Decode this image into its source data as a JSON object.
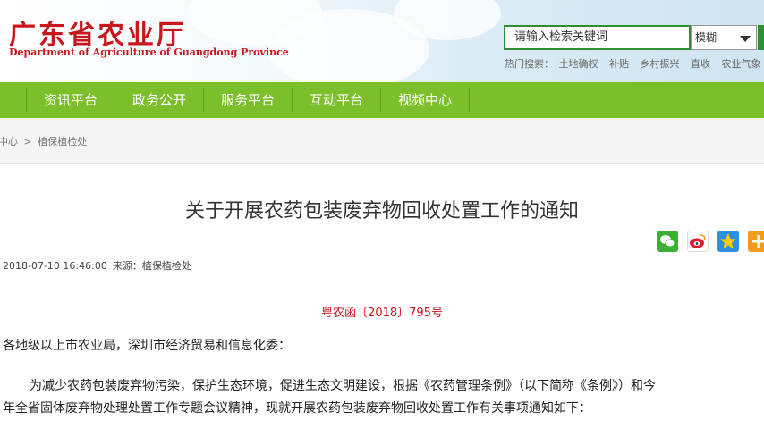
{
  "header": {
    "site_title_cn": "广东省农业厅",
    "site_title_en": "Department of Agriculture of Guangdong Province",
    "search": {
      "placeholder": "请输入检索关键词",
      "mode_selected": "模糊",
      "hot_label": "热门搜索：",
      "hot_terms": [
        "土地确权",
        "补贴",
        "乡村振兴",
        "直收",
        "农业气象"
      ]
    }
  },
  "nav": {
    "items": [
      "资讯平台",
      "政务公开",
      "服务平台",
      "互动平台",
      "视频中心"
    ]
  },
  "breadcrumb": {
    "items": [
      "中心",
      "植保植检处"
    ],
    "separator": ">"
  },
  "article": {
    "title": "关于开展农药包装废弃物回收处置工作的通知",
    "share_icons": [
      "wechat-icon",
      "weibo-icon",
      "qzone-icon",
      "more-share-icon"
    ],
    "date": "2018-07-10 16:46:00",
    "source_label": "来源：",
    "source": "植保植检处",
    "doc_number": "粤农函〔2018〕795号",
    "salutation": "各地级以上市农业局，深圳市经济贸易和信息化委：",
    "body_line1": "为减少农药包装废弃物污染，保护生态环境，促进生态文明建设，根据《农药管理条例》（以下简称《条例》）和今",
    "body_line2": "年全省固体废弃物处理处置工作专题会议精神，现就开展农药包装废弃物回收处置工作有关事项通知如下："
  },
  "colors": {
    "brand_red": "#c8161d",
    "nav_green": "#7bbf2b",
    "search_green": "#2f8f33"
  }
}
